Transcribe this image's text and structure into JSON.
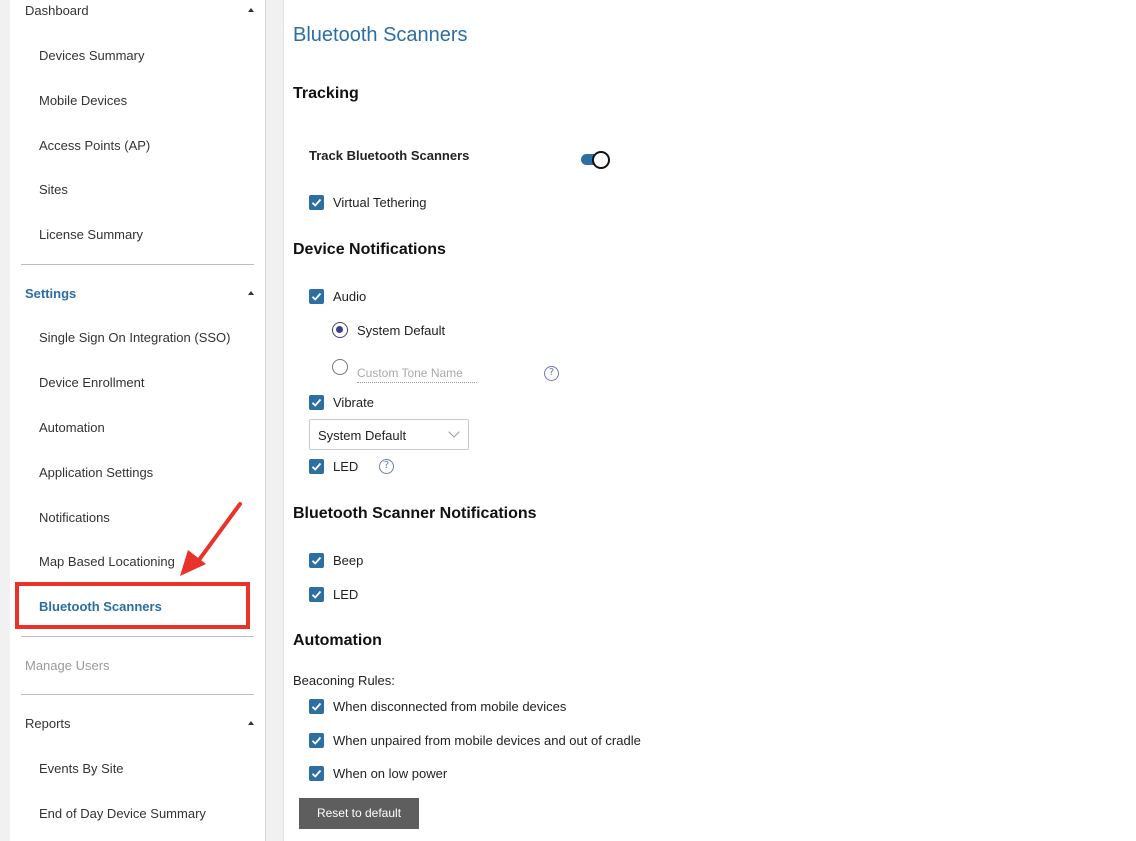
{
  "sidebar": {
    "dashboard": {
      "label": "Dashboard",
      "items": [
        "Devices Summary",
        "Mobile Devices",
        "Access Points (AP)",
        "Sites",
        "License Summary"
      ]
    },
    "settings": {
      "label": "Settings",
      "items": [
        "Single Sign On Integration (SSO)",
        "Device Enrollment",
        "Automation",
        "Application Settings",
        "Notifications",
        "Map Based Locationing",
        "Bluetooth Scanners"
      ]
    },
    "manage_users": "Manage Users",
    "reports": {
      "label": "Reports",
      "items": [
        "Events By Site",
        "End of Day Device Summary"
      ]
    },
    "active_item": "Bluetooth Scanners"
  },
  "main": {
    "title": "Bluetooth Scanners",
    "tracking": {
      "heading": "Tracking",
      "track_label": "Track Bluetooth Scanners",
      "track_enabled": true,
      "virtual_tethering": "Virtual Tethering"
    },
    "device_notifications": {
      "heading": "Device Notifications",
      "audio": "Audio",
      "system_default": "System Default",
      "custom_tone_placeholder": "Custom Tone Name",
      "vibrate": "Vibrate",
      "vibrate_select": "System Default",
      "led": "LED"
    },
    "scanner_notifications": {
      "heading": "Bluetooth Scanner Notifications",
      "beep": "Beep",
      "led": "LED"
    },
    "automation": {
      "heading": "Automation",
      "rules_label": "Beaconing Rules:",
      "rule_1": "When disconnected from mobile devices",
      "rule_2": "When unpaired from mobile devices and out of cradle",
      "rule_3": "When on low power"
    },
    "reset_button": "Reset to default"
  },
  "colors": {
    "accent": "#2b6ea3",
    "checkbox": "#2d6ea3",
    "highlight": "#e8322a",
    "button": "#5e5e5e"
  },
  "icons": {
    "checkbox": "check-icon",
    "help": "help-icon",
    "caret": "caret-up-icon",
    "arrow": "red-arrow-annotation"
  }
}
